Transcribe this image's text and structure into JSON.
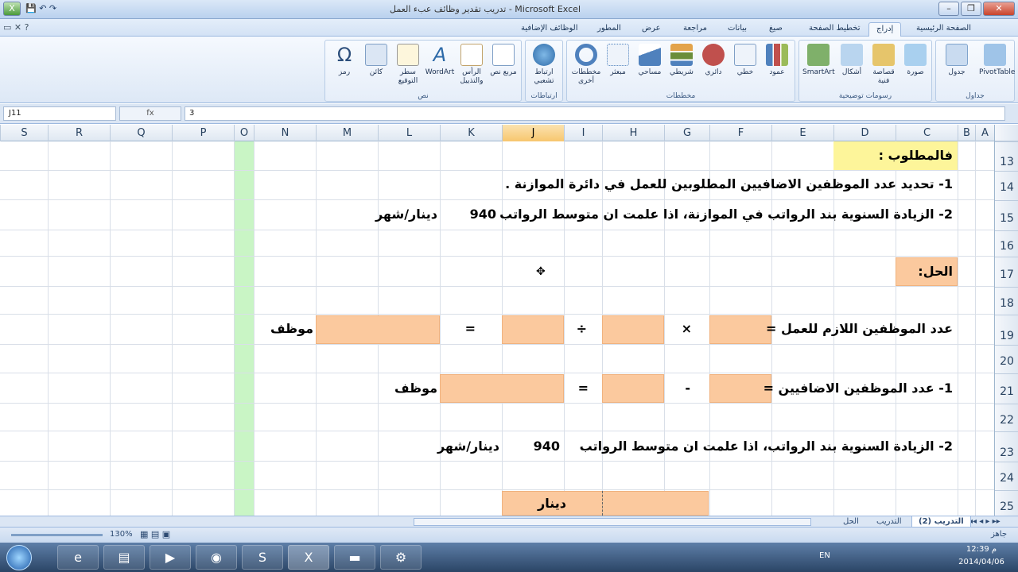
{
  "window": {
    "title": "تدريب تقدير وظائف عبء العمل - Microsoft Excel",
    "minimize": "–",
    "maximize": "❐",
    "close": "✕"
  },
  "ribbon_tabs": [
    "الصفحة الرئيسية",
    "إدراج",
    "تخطيط الصفحة",
    "صيغ",
    "بيانات",
    "مراجعة",
    "عرض",
    "المطور",
    "الوظائف الإضافية"
  ],
  "ribbon": {
    "groups": [
      {
        "label": "جداول",
        "buttons": [
          "PivotTable",
          "جدول"
        ]
      },
      {
        "label": "رسومات توضيحية",
        "buttons": [
          "صورة",
          "قصاصة فنية",
          "أشكال",
          "SmartArt"
        ]
      },
      {
        "label": "مخططات",
        "buttons": [
          "عمود",
          "خطي",
          "دائري",
          "شريطي",
          "مساحي",
          "مبعثر",
          "مخططات أخرى"
        ]
      },
      {
        "label": "ارتباطات",
        "buttons": [
          "ارتباط تشعبي"
        ]
      },
      {
        "label": "نص",
        "buttons": [
          "مربع نص",
          "الرأس والتذييل",
          "WordArt",
          "سطر التوقيع",
          "كائن",
          "رمز"
        ]
      }
    ]
  },
  "formula_bar": {
    "name_box": "J11",
    "fx": "fx",
    "value": "3"
  },
  "columns": [
    "C",
    "D",
    "E",
    "F",
    "G",
    "H",
    "I",
    "J",
    "K",
    "L",
    "M",
    "N",
    "O",
    "P",
    "Q",
    "R",
    "S"
  ],
  "left_columns": [
    "A",
    "B"
  ],
  "rows": [
    "13",
    "14",
    "15",
    "16",
    "17",
    "18",
    "19",
    "20",
    "21",
    "22",
    "23",
    "24",
    "25"
  ],
  "cells": {
    "r13": "فالمطلوب :",
    "r14": "1- تحديد عدد الموظفين الاضافيين المطلوبين للعمل في دائرة الموازنة .",
    "r15": "2- الزيادة  السنوية بند الرواتب  في الموازنة، اذا علمت ان متوسط الرواتب",
    "r15_value": "940",
    "r15_unit": "دينار/شهر",
    "r17": "الحل:",
    "r19_label": "عدد الموظفين اللازم للعمل =",
    "r19_times": "×",
    "r19_div": "÷",
    "r19_eq": "=",
    "r19_unit": "موظف",
    "r21_label": "1- عدد الموظفين الاضافيين =",
    "r21_minus": "-",
    "r21_eq": "=",
    "r21_unit": "موظف",
    "r23_label": "2- الزيادة  السنوية بند الرواتب، اذا علمت ان متوسط الرواتب",
    "r23_value": "940",
    "r23_unit": "دينار/شهر",
    "r25": "دينار"
  },
  "sheet_tabs": [
    "التدريب (2)",
    "التدريب",
    "الحل"
  ],
  "status": {
    "ready": "جاهز",
    "zoom": "130%"
  },
  "taskbar": {
    "lang": "EN",
    "time": "12:39 م",
    "date": "2014/04/06"
  },
  "colors": {
    "peach": "#fbc99e",
    "yellow": "#fdf59a",
    "selected_col": "#f7c66e",
    "green_band": "#c9f5c5"
  }
}
